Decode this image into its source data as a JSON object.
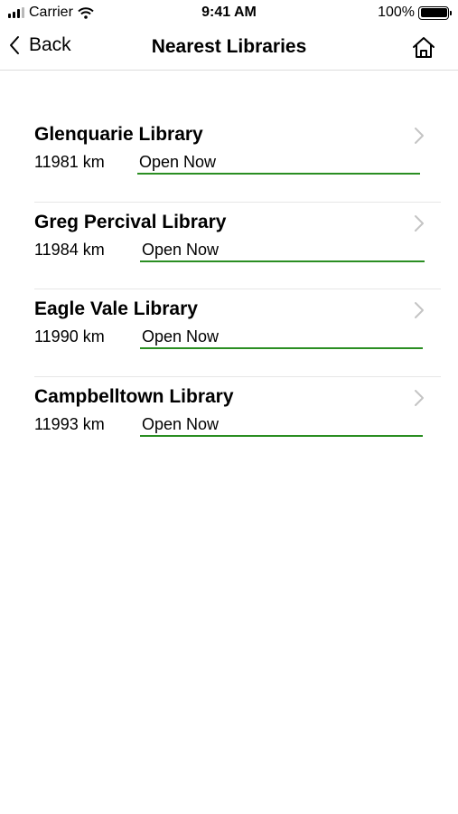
{
  "status_bar": {
    "carrier": "Carrier",
    "time": "9:41 AM",
    "battery": "100%"
  },
  "nav": {
    "back_label": "Back",
    "title": "Nearest Libraries"
  },
  "libraries": [
    {
      "name": "Glenquarie Library",
      "distance": "11981 km",
      "status": "Open Now"
    },
    {
      "name": "Greg Percival Library",
      "distance": "11984 km",
      "status": "Open Now"
    },
    {
      "name": "Eagle Vale Library",
      "distance": "11990 km",
      "status": "Open Now"
    },
    {
      "name": "Campbelltown Library",
      "distance": "11993 km",
      "status": "Open Now"
    }
  ],
  "colors": {
    "status_underline": "#2a8e22",
    "chevron": "#c4c4c4"
  }
}
